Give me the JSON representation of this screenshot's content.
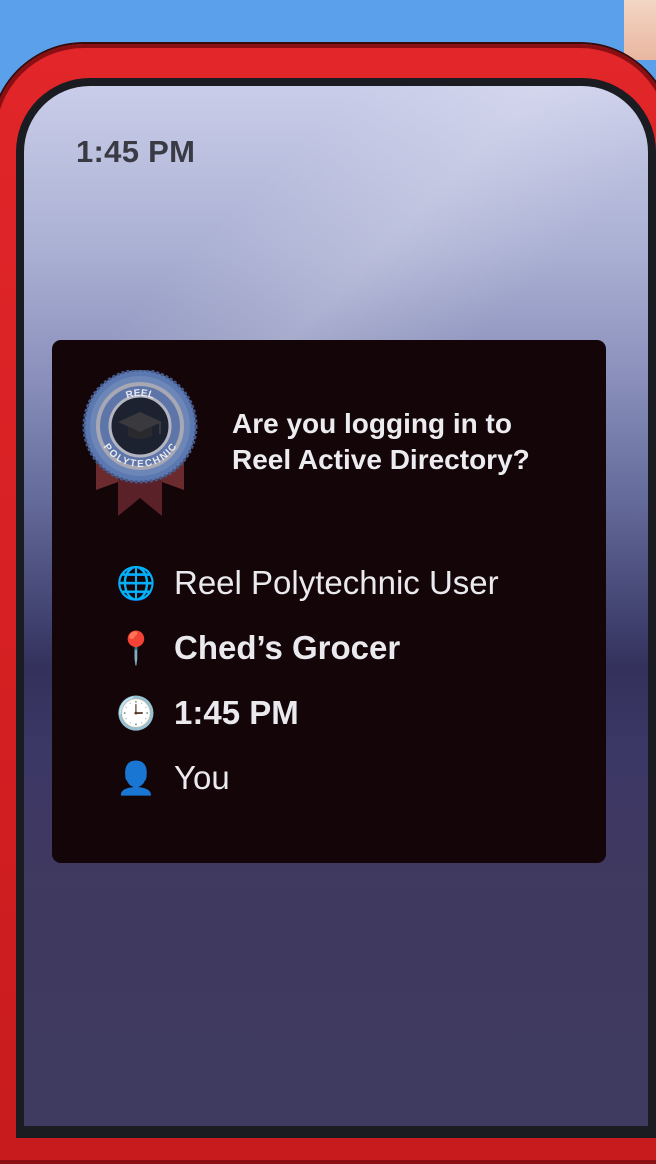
{
  "status_bar": {
    "time": "1:45 PM"
  },
  "badge": {
    "top_text": "REEL",
    "bottom_text": "POLYTECHNIC",
    "icon": "graduation-cap-icon"
  },
  "prompt": {
    "headline_line1": "Are you logging in to",
    "headline_line2": "Reel Active Directory?"
  },
  "details": [
    {
      "icon": "globe-icon",
      "emoji": "🌐",
      "text": "Reel Polytechnic User",
      "bold": false
    },
    {
      "icon": "pushpin-icon",
      "emoji": "📍",
      "text": "Ched’s Grocer",
      "bold": true
    },
    {
      "icon": "clock-icon",
      "emoji": "🕒",
      "text": "1:45 PM",
      "bold": true
    },
    {
      "icon": "user-silhouette-icon",
      "emoji": "👤",
      "text": "You",
      "bold": false
    }
  ],
  "colors": {
    "frame": "#e2262a",
    "card": "#140508",
    "badge_ring": "#6d86b8",
    "ribbon": "#6b2a2e"
  }
}
